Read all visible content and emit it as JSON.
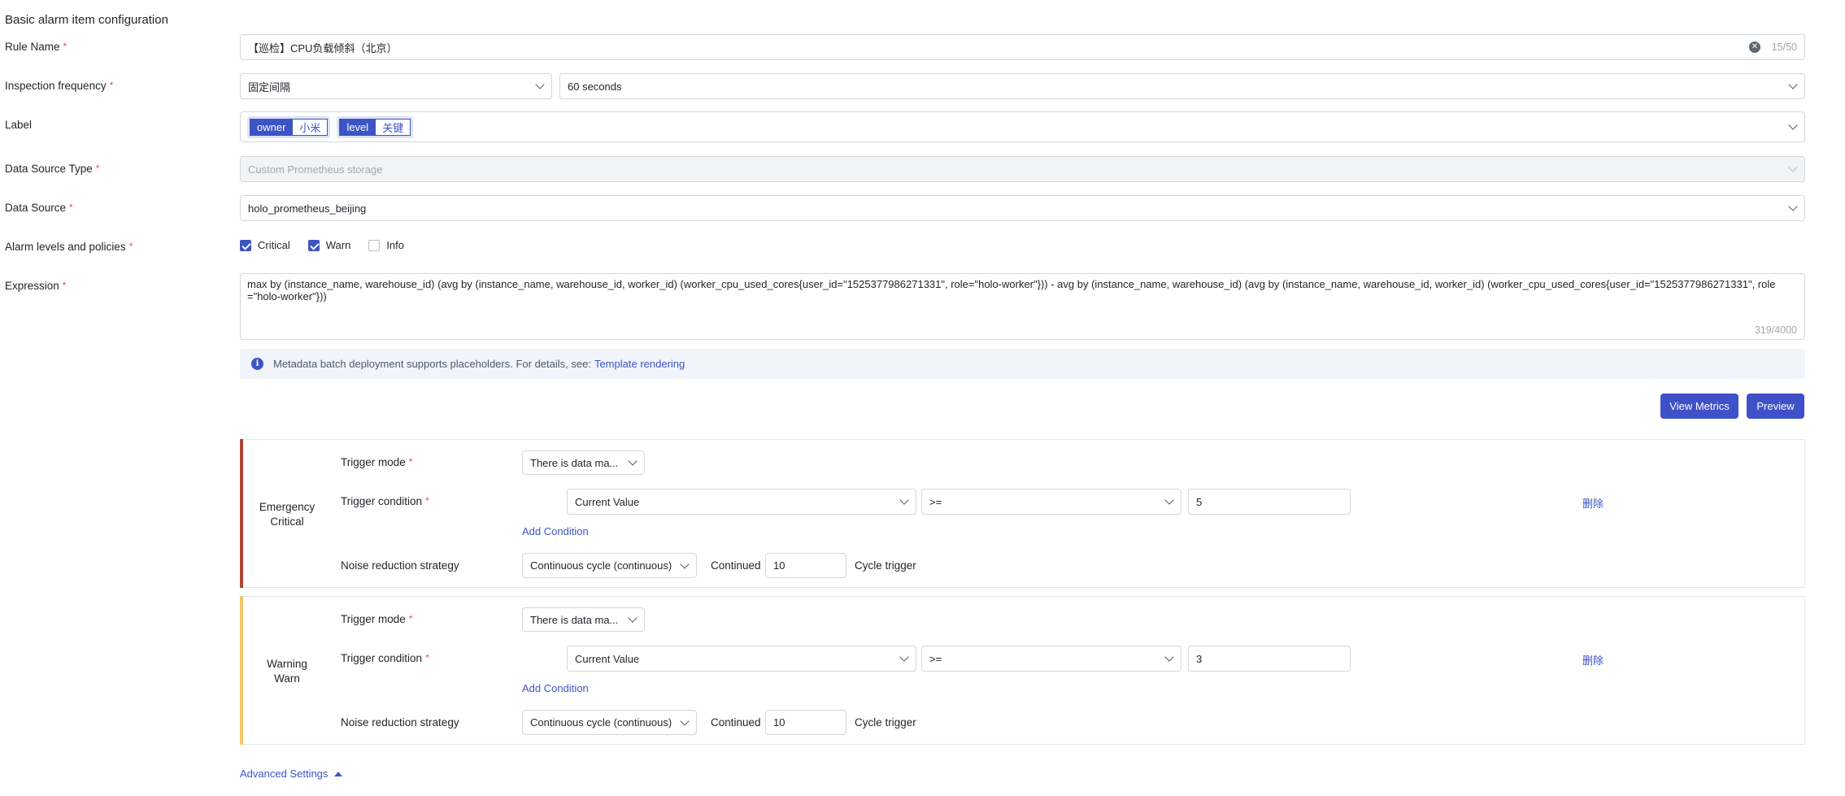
{
  "section_title": "Basic alarm item configuration",
  "rule_name": {
    "label": "Rule Name",
    "value": "【巡检】CPU负载倾斜（北京）",
    "counter": "15/50"
  },
  "inspection": {
    "label": "Inspection frequency",
    "mode": "固定间隔",
    "interval": "60 seconds"
  },
  "label_field": {
    "label": "Label",
    "tags": [
      {
        "key": "owner",
        "value": "小米"
      },
      {
        "key": "level",
        "value": "关键"
      }
    ]
  },
  "ds_type": {
    "label": "Data Source Type",
    "value": "Custom Prometheus storage"
  },
  "ds": {
    "label": "Data Source",
    "value": "holo_prometheus_beijing"
  },
  "levels": {
    "label": "Alarm levels and policies",
    "options": [
      {
        "label": "Critical",
        "checked": true
      },
      {
        "label": "Warn",
        "checked": true
      },
      {
        "label": "Info",
        "checked": false
      }
    ]
  },
  "expression": {
    "label": "Expression",
    "value": "max by (instance_name, warehouse_id) (avg by (instance_name, warehouse_id, worker_id) (worker_cpu_used_cores{user_id=\"1525377986271331\", role=\"holo-worker\"})) - avg by (instance_name, warehouse_id) (avg by (instance_name, warehouse_id, worker_id) (worker_cpu_used_cores{user_id=\"1525377986271331\", role=\"holo-worker\"}))",
    "counter": "319/4000"
  },
  "info": {
    "text": "Metadata batch deployment supports placeholders. For details, see:",
    "link": "Template rendering"
  },
  "buttons": {
    "view_metrics": "View Metrics",
    "preview": "Preview"
  },
  "panels": [
    {
      "name_line1": "Emergency",
      "name_line2": "Critical",
      "trigger_mode_label": "Trigger mode",
      "trigger_mode": "There is data ma...",
      "trigger_condition_label": "Trigger condition",
      "cond_field": "Current Value",
      "cond_op": ">=",
      "cond_value": "5",
      "delete": "删除",
      "add_condition": "Add Condition",
      "noise_label": "Noise reduction strategy",
      "noise_value": "Continuous cycle (continuous)",
      "continued": "Continued",
      "cycles": "10",
      "cycle_trigger": "Cycle trigger",
      "accent": "#b04434"
    },
    {
      "name_line1": "Warning",
      "name_line2": "Warn",
      "trigger_mode_label": "Trigger mode",
      "trigger_mode": "There is data ma...",
      "trigger_condition_label": "Trigger condition",
      "cond_field": "Current Value",
      "cond_op": ">=",
      "cond_value": "3",
      "delete": "删除",
      "add_condition": "Add Condition",
      "noise_label": "Noise reduction strategy",
      "noise_value": "Continuous cycle (continuous)",
      "continued": "Continued",
      "cycles": "10",
      "cycle_trigger": "Cycle trigger",
      "accent": "#f3c86a"
    }
  ],
  "advanced": "Advanced Settings",
  "colors": {
    "primary": "#3f51c8",
    "required": "#e34d59"
  }
}
